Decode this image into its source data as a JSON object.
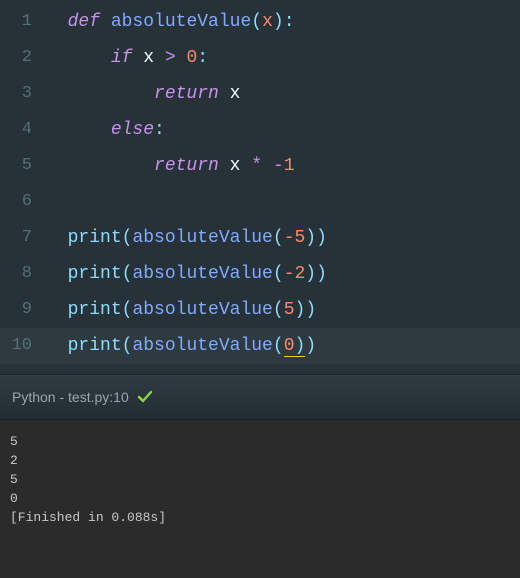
{
  "editor": {
    "lines": [
      {
        "num": "1"
      },
      {
        "num": "2"
      },
      {
        "num": "3"
      },
      {
        "num": "4"
      },
      {
        "num": "5"
      },
      {
        "num": "6"
      },
      {
        "num": "7"
      },
      {
        "num": "8"
      },
      {
        "num": "9"
      },
      {
        "num": "10"
      }
    ],
    "tokens": {
      "def": "def",
      "if": "if",
      "else": "else",
      "return": "return",
      "fn_name": "absoluteValue",
      "param_x": "x",
      "gt": ">",
      "star": "*",
      "minus": "-",
      "colon": ":",
      "lparen": "(",
      "rparen": ")",
      "zero": "0",
      "one": "1",
      "neg5": "-5",
      "neg2": "-2",
      "pos5": "5",
      "print": "print"
    }
  },
  "status": {
    "text": "Python - test.py:10"
  },
  "console": {
    "lines": [
      "5",
      "2",
      "5",
      "0",
      "[Finished in 0.088s]"
    ]
  }
}
